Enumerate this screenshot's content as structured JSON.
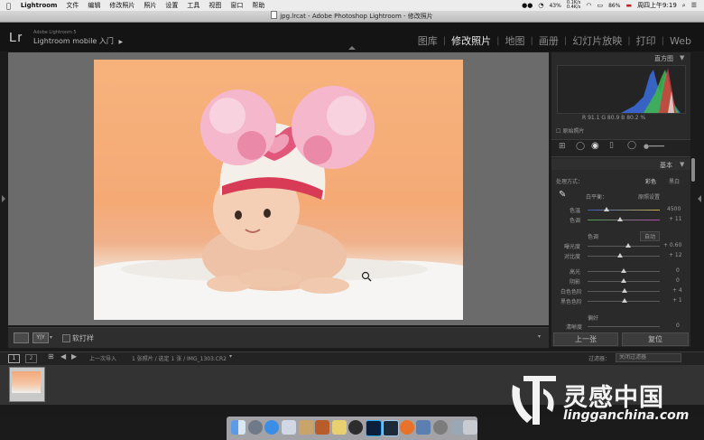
{
  "menubar": {
    "app": "Lightroom",
    "items": [
      "文件",
      "编辑",
      "修改照片",
      "照片",
      "设置",
      "工具",
      "视图",
      "窗口",
      "帮助"
    ],
    "battery_level": "43%",
    "net_up": "0.1K/s",
    "net_down": "0.4K/s",
    "wifi_strength": "86%",
    "datetime": "周四上午9:19"
  },
  "window": {
    "title": "jpg.lrcat - Adobe Photoshop Lightroom - 修改照片"
  },
  "header": {
    "logo": "Lr",
    "product": "Adobe Lightroom 5",
    "mobile_label": "Lightroom mobile 入门",
    "mobile_arrow": "▶",
    "modules": [
      {
        "label": "图库",
        "active": false
      },
      {
        "label": "修改照片",
        "active": true
      },
      {
        "label": "地图",
        "active": false
      },
      {
        "label": "画册",
        "active": false
      },
      {
        "label": "幻灯片放映",
        "active": false
      },
      {
        "label": "打印",
        "active": false
      },
      {
        "label": "Web",
        "active": false
      }
    ]
  },
  "histogram": {
    "title": "直方图",
    "readout": "R 91.1  G 80.9  B 80.2 %",
    "original_label": "原始照片"
  },
  "basic": {
    "title": "基本",
    "treatment_label": "处理方式：",
    "treatment_color": "彩色",
    "treatment_bw": "黑白",
    "wb_label": "白平衡：",
    "wb_value": "原照设置",
    "temp_label": "色温",
    "temp_value": "4500",
    "tint_label": "色调",
    "tint_value": "+ 11",
    "tone_label": "色调",
    "auto_label": "自动",
    "exposure_label": "曝光度",
    "exposure_value": "+ 0.60",
    "contrast_label": "对比度",
    "contrast_value": "+ 12",
    "highlights_label": "高光",
    "highlights_value": "0",
    "shadows_label": "阴影",
    "shadows_value": "0",
    "whites_label": "白色色阶",
    "whites_value": "+ 4",
    "blacks_label": "黑色色阶",
    "blacks_value": "+ 1",
    "presence_label": "偏好",
    "clarity_label": "清晰度",
    "clarity_value": "0",
    "prev_button": "上一张",
    "reset_button": "复位"
  },
  "toolbar": {
    "view_label": "Y|Y",
    "softproof_label": "软打样"
  },
  "filmstrip": {
    "page1": "1",
    "page2": "2",
    "nav_text": "上一次导入",
    "path_text": "1 张照片 / 选定 1 张 / IMG_1303.CR2",
    "filter_label": "过滤器：",
    "filter_value": "关闭过滤器"
  },
  "watermark": {
    "cn": "灵感中国",
    "url": "lingganchina.com"
  },
  "colors": {
    "accent_active": "#e8e8e8",
    "panel_bg": "#2a2a2a",
    "canvas_bg": "#6b6b6b"
  }
}
